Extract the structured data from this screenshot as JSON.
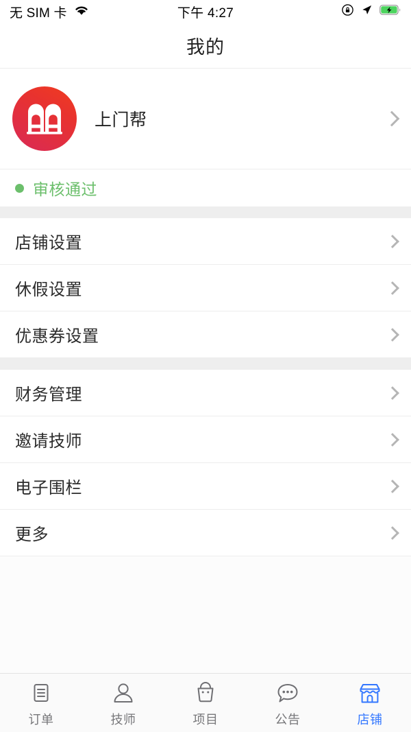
{
  "status_bar": {
    "carrier": "无 SIM 卡",
    "time": "下午 4:27",
    "wifi_icon": "wifi-icon",
    "rotation_lock_icon": "rotation-lock-icon",
    "location_icon": "location-arrow-icon",
    "battery_icon": "battery-charging-icon"
  },
  "header": {
    "title": "我的"
  },
  "profile": {
    "shop_name": "上门帮",
    "avatar_icon": "shop-logo-avatar",
    "chevron_icon": "chevron-right-icon",
    "status_label": "审核通过",
    "status_color": "#6cbf6c"
  },
  "groups": [
    {
      "items": [
        {
          "label": "店铺设置"
        },
        {
          "label": "休假设置"
        },
        {
          "label": "优惠券设置"
        }
      ]
    },
    {
      "items": [
        {
          "label": "财务管理"
        },
        {
          "label": "邀请技师"
        },
        {
          "label": "电子围栏"
        },
        {
          "label": "更多"
        }
      ]
    }
  ],
  "tabbar": {
    "active_color": "#3377ff",
    "inactive_color": "#77777a",
    "tabs": [
      {
        "label": "订单",
        "icon": "document-icon",
        "active": false
      },
      {
        "label": "技师",
        "icon": "person-icon",
        "active": false
      },
      {
        "label": "项目",
        "icon": "shopping-bag-icon",
        "active": false
      },
      {
        "label": "公告",
        "icon": "chat-bubble-icon",
        "active": false
      },
      {
        "label": "店铺",
        "icon": "storefront-icon",
        "active": true
      }
    ]
  }
}
